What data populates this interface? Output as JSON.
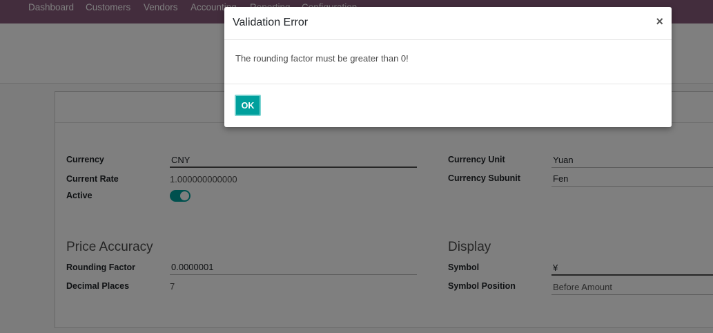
{
  "navbar": {
    "items": [
      "Dashboard",
      "Customers",
      "Vendors",
      "Accounting",
      "Reporting",
      "Configuration"
    ]
  },
  "form": {
    "currency_label": "Currency",
    "currency_value": "CNY",
    "current_rate_label": "Current Rate",
    "current_rate_value": "1.000000000000",
    "active_label": "Active",
    "active_on": true,
    "currency_unit_label": "Currency Unit",
    "currency_unit_value": "Yuan",
    "currency_subunit_label": "Currency Subunit",
    "currency_subunit_value": "Fen",
    "price_accuracy_title": "Price Accuracy",
    "rounding_factor_label": "Rounding Factor",
    "rounding_factor_value": "0.0000001",
    "decimal_places_label": "Decimal Places",
    "decimal_places_value": "7",
    "display_title": "Display",
    "symbol_label": "Symbol",
    "symbol_value": "¥",
    "symbol_position_label": "Symbol Position",
    "symbol_position_value": "Before Amount"
  },
  "dialog": {
    "title": "Validation Error",
    "close_glyph": "×",
    "message": "The rounding factor must be greater than 0!",
    "ok_label": "OK"
  },
  "colors": {
    "navbar": "#875a7b",
    "primary": "#00a09d"
  }
}
